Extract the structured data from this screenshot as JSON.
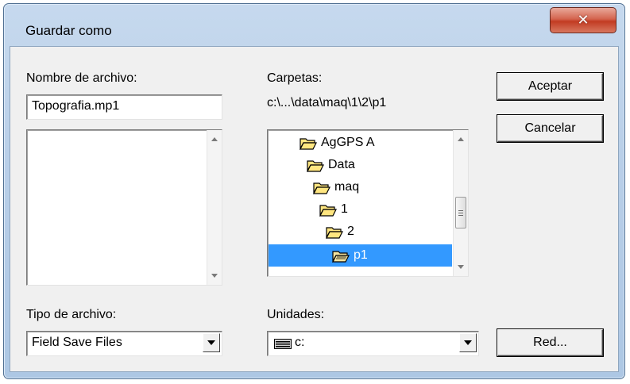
{
  "window": {
    "title": "Guardar como",
    "close_glyph": "✕"
  },
  "filename": {
    "label": "Nombre de archivo:",
    "value": "Topografia.mp1"
  },
  "folders": {
    "label": "Carpetas:",
    "path": "c:\\...\\data\\maq\\1\\2\\p1",
    "items": [
      {
        "label": "AgGPS A",
        "icon": "folder-open-icon",
        "selected": false
      },
      {
        "label": "Data",
        "icon": "folder-open-icon",
        "selected": false
      },
      {
        "label": "maq",
        "icon": "folder-open-icon",
        "selected": false
      },
      {
        "label": "1",
        "icon": "folder-open-icon",
        "selected": false
      },
      {
        "label": "2",
        "icon": "folder-open-icon",
        "selected": false
      },
      {
        "label": "p1",
        "icon": "folder-open-icon",
        "selected": true
      }
    ]
  },
  "buttons": {
    "accept": "Aceptar",
    "cancel": "Cancelar",
    "network": "Red..."
  },
  "file_type": {
    "label": "Tipo de archivo:",
    "value": "Field Save Files"
  },
  "drives": {
    "label": "Unidades:",
    "value": "c:",
    "icon": "drive-icon"
  },
  "colors": {
    "selection": "#3399ff",
    "close_button": "#c9442a",
    "folder": "#ffe680"
  }
}
